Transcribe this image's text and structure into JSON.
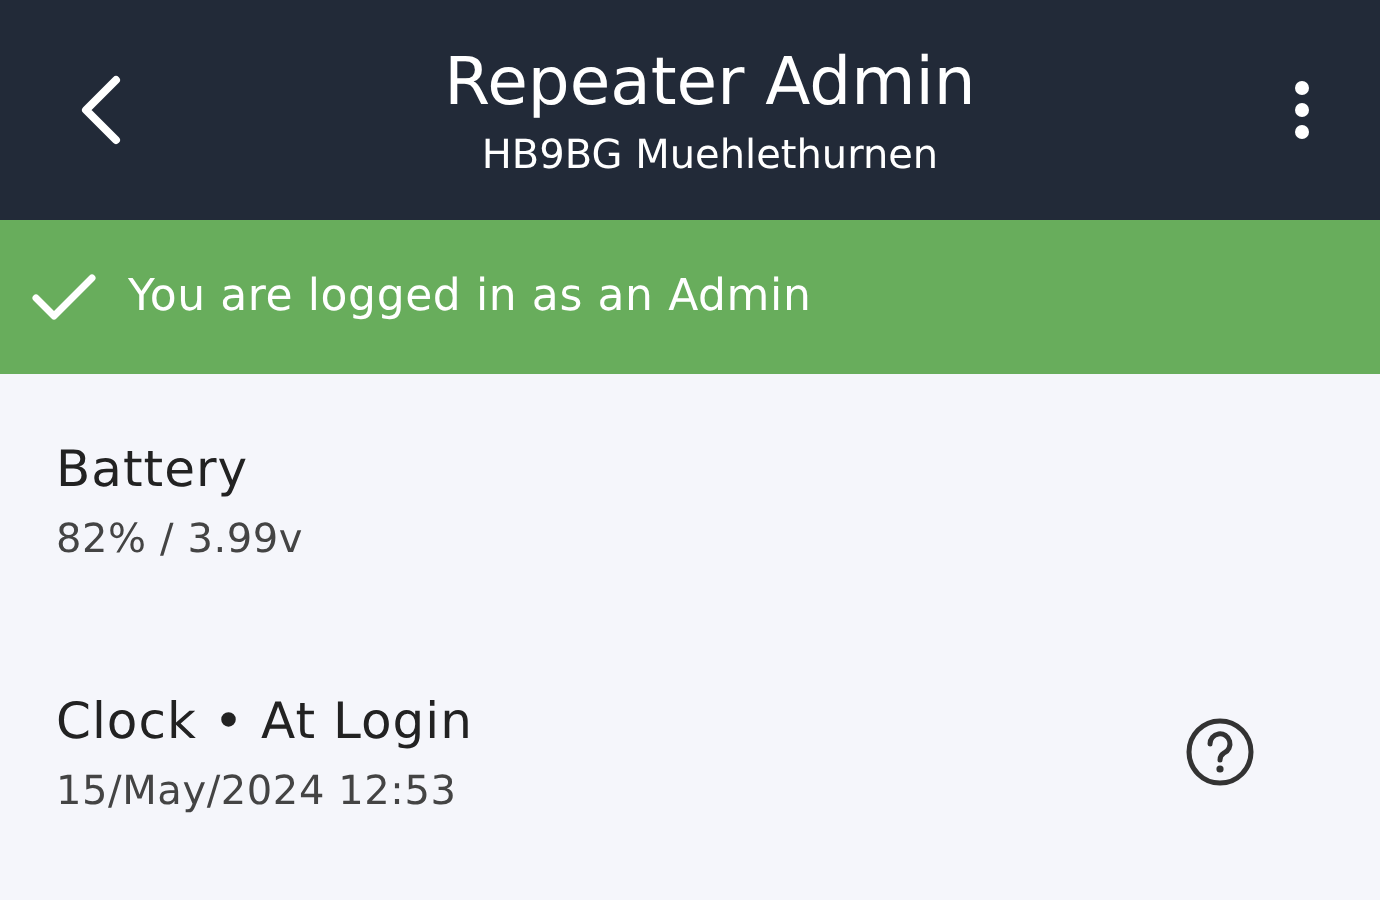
{
  "header": {
    "title": "Repeater Admin",
    "subtitle": "HB9BG Muehlethurnen"
  },
  "banner": {
    "text": "You are logged in as an Admin"
  },
  "items": [
    {
      "title": "Battery",
      "value": "82% / 3.99v",
      "help": false
    },
    {
      "title": "Clock • At Login",
      "value": "15/May/2024 12:53",
      "help": true
    }
  ]
}
